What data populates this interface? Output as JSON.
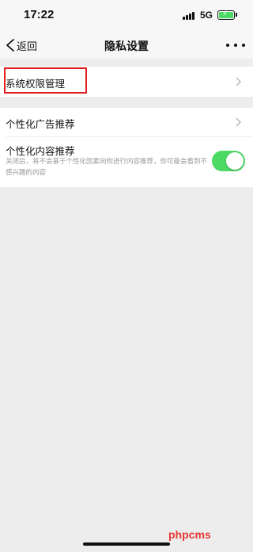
{
  "status_bar": {
    "time": "17:22",
    "network": "5G",
    "icons": [
      "signal-icon",
      "battery-charging-icon"
    ]
  },
  "nav": {
    "back_label": "返回",
    "title": "隐私设置",
    "more_icon": "more-dots-icon"
  },
  "settings": {
    "system_permissions": "系统权限管理",
    "personalized_ads": "个性化广告推荐",
    "personalized_content": {
      "label": "个性化内容推荐",
      "description": "关闭后，将不会基于个性化因素向你进行内容推荐，你可能会看到不感兴趣的内容",
      "enabled": true
    }
  },
  "colors": {
    "toggle_on": "#4cd964",
    "highlight": "#e02020",
    "background": "#ededed"
  },
  "watermark": "phpcms"
}
